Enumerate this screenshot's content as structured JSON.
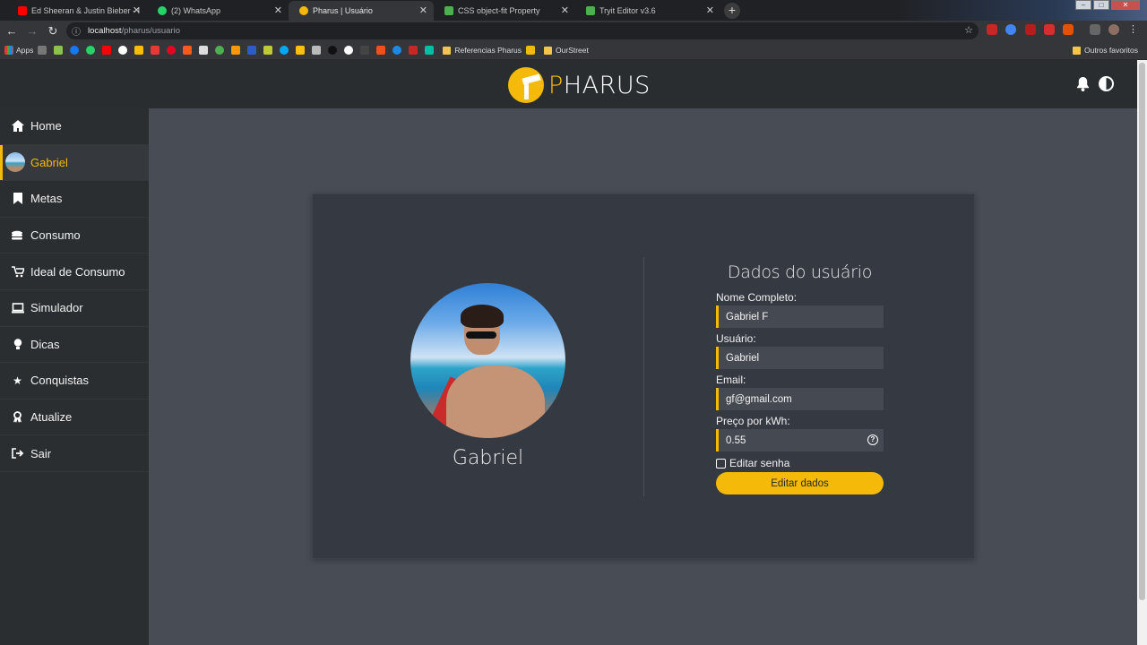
{
  "browser": {
    "tabs": [
      {
        "title": "Ed Sheeran & Justin Bieber - I Do",
        "favicon_color": "#ff0000",
        "active": false
      },
      {
        "title": "(2) WhatsApp",
        "favicon_color": "#25d366",
        "active": false
      },
      {
        "title": "Pharus | Usuário",
        "favicon_color": "#f5b90a",
        "active": true
      },
      {
        "title": "CSS object-fit Property",
        "favicon_color": "#4caf50",
        "active": false
      },
      {
        "title": "Tryit Editor v3.6",
        "favicon_color": "#4caf50",
        "active": false
      }
    ],
    "url_host": "localhost",
    "url_path": "/pharus/usuario",
    "bookmarks": {
      "apps_label": "Apps",
      "folder_referencias": "Referencias Pharus",
      "folder_ourstreet": "OurStreet",
      "other_favorites": "Outros favoritos"
    }
  },
  "app": {
    "brand_prefix": "P",
    "brand_rest": "HARUS",
    "accent": "#f5b90a",
    "sidebar": {
      "items": [
        {
          "label": "Home",
          "icon": "home-icon"
        },
        {
          "label": "Gabriel",
          "icon": "avatar",
          "active": true
        },
        {
          "label": "Metas",
          "icon": "bookmark-icon"
        },
        {
          "label": "Consumo",
          "icon": "coins-icon"
        },
        {
          "label": "Ideal de Consumo",
          "icon": "cart-icon"
        },
        {
          "label": "Simulador",
          "icon": "laptop-icon"
        },
        {
          "label": "Dicas",
          "icon": "lightbulb-icon"
        },
        {
          "label": "Conquistas",
          "icon": "star-icon"
        },
        {
          "label": "Atualize",
          "icon": "award-icon"
        },
        {
          "label": "Sair",
          "icon": "sign-out-icon"
        }
      ]
    },
    "profile": {
      "display_name": "Gabriel"
    },
    "form": {
      "title": "Dados do usuário",
      "full_name_label": "Nome Completo:",
      "full_name_value": "Gabriel F",
      "username_label": "Usuário:",
      "username_value": "Gabriel",
      "email_label": "Email:",
      "email_value": "gf@gmail.com",
      "price_label": "Preço por kWh:",
      "price_value": "0.55",
      "edit_password_label": "Editar senha",
      "edit_data_button": "Editar dados"
    }
  }
}
